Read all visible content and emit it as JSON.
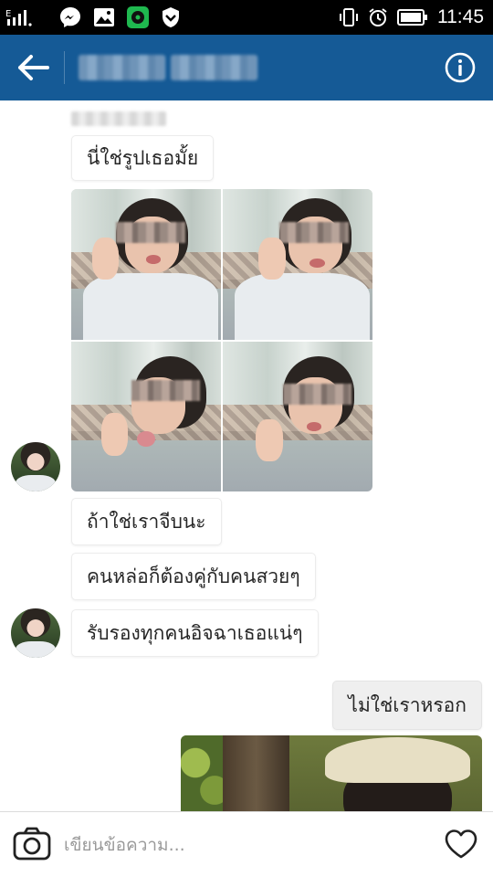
{
  "status_bar": {
    "time": "11:45",
    "signal_label": "E",
    "icons": [
      "signal-icon",
      "messenger-icon",
      "gallery-icon",
      "music-app-icon",
      "shield-icon",
      "vibrate-icon",
      "alarm-icon",
      "battery-icon"
    ]
  },
  "header": {
    "title": "",
    "icons": [
      "back-arrow-icon",
      "info-icon"
    ]
  },
  "messages": [
    {
      "type": "text",
      "direction": "incoming",
      "text": "นี่ใช่รูปเธอมั้ย"
    },
    {
      "type": "image",
      "direction": "incoming",
      "description_icon": "photo-collage"
    },
    {
      "type": "text",
      "direction": "incoming",
      "text": "ถ้าใช่เราจีบนะ"
    },
    {
      "type": "text",
      "direction": "incoming",
      "text": "คนหล่อก็ต้องคู่กับคนสวยๆ"
    },
    {
      "type": "text",
      "direction": "incoming",
      "text": "รับรองทุกคนอิจฉาเธอแน่ๆ"
    },
    {
      "type": "text",
      "direction": "outgoing",
      "text": "ไม่ใช่เราหรอก"
    },
    {
      "type": "image",
      "direction": "outgoing",
      "description_icon": "photo"
    }
  ],
  "composer": {
    "placeholder": "เขียนข้อความ...",
    "value": "",
    "icons": [
      "camera-icon",
      "heart-icon"
    ]
  },
  "colors": {
    "header_bg": "#155a96",
    "status_bar_bg": "#000000",
    "incoming_bubble": "#ffffff",
    "outgoing_bubble": "#efefef"
  }
}
